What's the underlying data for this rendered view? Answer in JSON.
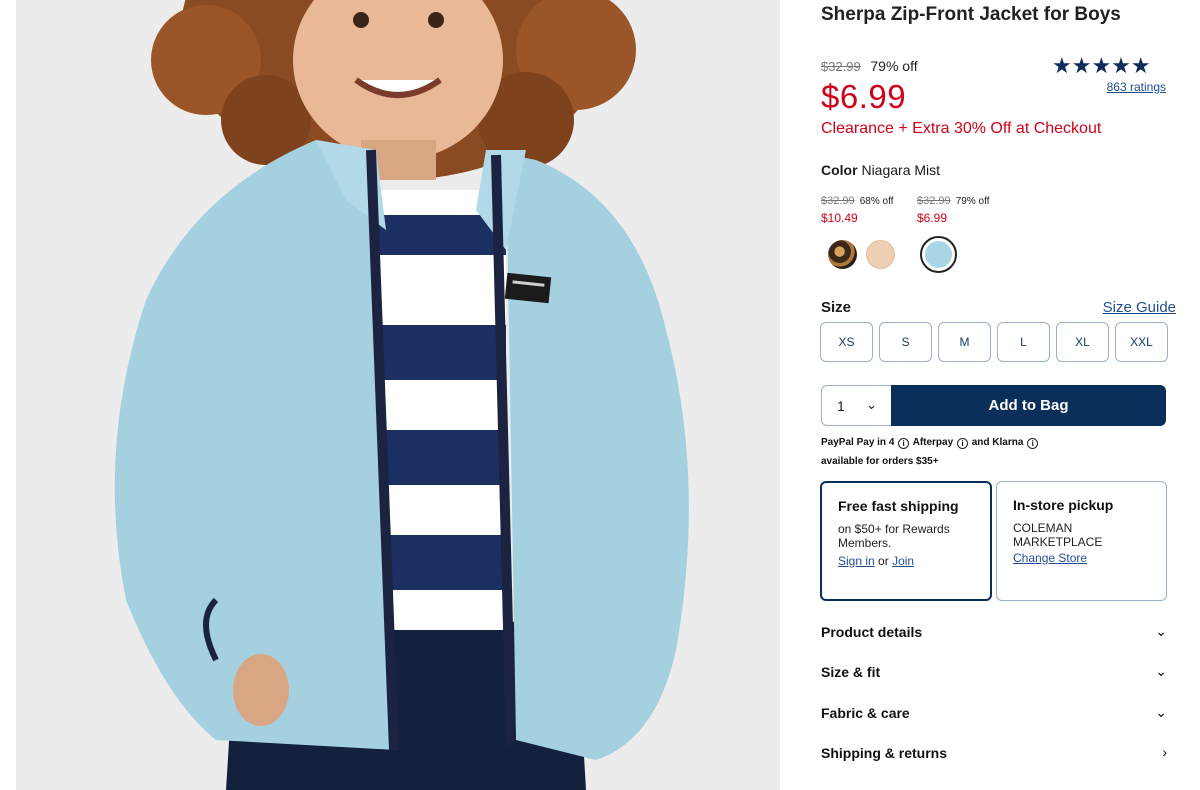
{
  "product": {
    "title": "Sherpa Zip-Front Jacket for Boys",
    "original_price": "$32.99",
    "discount": "79% off",
    "sale_price": "$6.99",
    "promo": "Clearance + Extra 30% Off at Checkout",
    "rating_stars": "★★★★★",
    "rating_value": 5,
    "ratings_link": "863 ratings"
  },
  "image": {
    "icon": "product-photo-boy-in-blue-sherpa-jacket"
  },
  "color": {
    "label": "Color",
    "selected": "Niagara Mist",
    "variants": [
      {
        "original": "$32.99",
        "discount": "68% off",
        "sale": "$10.49"
      },
      {
        "original": "$32.99",
        "discount": "79% off",
        "sale": "$6.99"
      }
    ],
    "swatches": [
      {
        "name": "brown-pattern",
        "color": "#6b4a2a"
      },
      {
        "name": "peach",
        "color": "#efcfb3"
      },
      {
        "name": "niagara-mist",
        "color": "#a8d6e4",
        "selected": true
      }
    ]
  },
  "size": {
    "label": "Size",
    "guide": "Size Guide",
    "options": [
      "XS",
      "S",
      "M",
      "L",
      "XL",
      "XXL"
    ]
  },
  "cart": {
    "quantity": "1",
    "chevron": "⌄",
    "add_label": "Add to Bag"
  },
  "payment": {
    "paypal": "PayPal Pay in 4",
    "afterpay": "Afterpay",
    "and": "and",
    "klarna": "Klarna",
    "availability": "available for orders $35+",
    "info_glyph": "i"
  },
  "fulfillment": {
    "shipping": {
      "title": "Free fast shipping",
      "text": "on $50+ for Rewards Members.",
      "sign_in": "Sign in",
      "or": "or",
      "join": "Join"
    },
    "pickup": {
      "title": "In-store pickup",
      "store": "COLEMAN MARKETPLACE",
      "change": "Change Store"
    }
  },
  "accordions": [
    {
      "label": "Product details",
      "chevron": "⌄"
    },
    {
      "label": "Size & fit",
      "chevron": "⌄"
    },
    {
      "label": "Fabric & care",
      "chevron": "⌄"
    },
    {
      "label": "Shipping & returns",
      "chevron": "›"
    }
  ],
  "colors": {
    "sale_red": "#d0021b",
    "navy": "#0b2f5b",
    "link_blue": "#1f4d92",
    "jacket_blue": "#a8d6e4"
  }
}
